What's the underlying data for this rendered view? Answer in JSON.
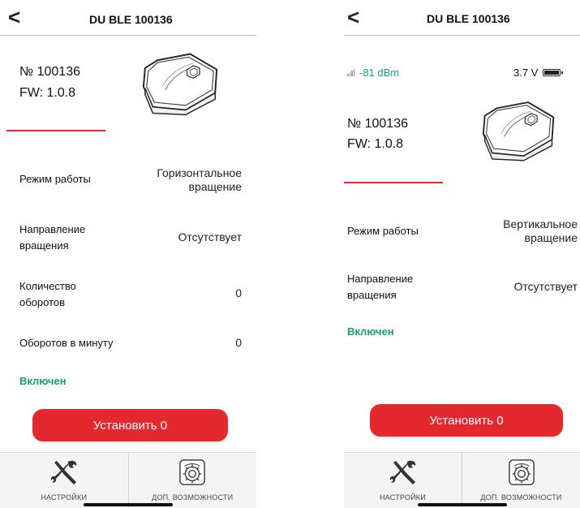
{
  "left": {
    "header": {
      "back_icon": "chevron-left-icon",
      "back_glyph": "<",
      "title": "DU BLE 100136"
    },
    "device": {
      "number": "№ 100136",
      "fw": "FW: 1.0.8"
    },
    "rows": [
      {
        "label": "Режим работы",
        "value": "Горизонтальное вращение"
      },
      {
        "label": "Направление вращения",
        "value": "Отсутствует"
      },
      {
        "label": "Количество оборотов",
        "value": "0"
      },
      {
        "label": "Оборотов в минуту",
        "value": "0"
      }
    ],
    "status": "Включен",
    "action_button": "Установить 0",
    "tabs": [
      {
        "label": "НАСТРОЙКИ",
        "icon": "wrench-screwdriver-icon"
      },
      {
        "label": "ДОП. ВОЗМОЖНОСТИ",
        "icon": "gear-icon"
      }
    ]
  },
  "right": {
    "header": {
      "back_icon": "chevron-left-icon",
      "back_glyph": "<",
      "title": "DU BLE 100136"
    },
    "signal": {
      "value": "-81 dBm",
      "icon": "signal-bars-icon"
    },
    "voltage": {
      "value": "3.7 V",
      "icon": "battery-icon"
    },
    "device": {
      "number": "№ 100136",
      "fw": "FW: 1.0.8"
    },
    "rows": [
      {
        "label": "Режим работы",
        "value": "Вертикальное вращение"
      },
      {
        "label": "Направление вращения",
        "value": "Отсутствует"
      }
    ],
    "status": "Включен",
    "action_button": "Установить 0",
    "tabs": [
      {
        "label": "НАСТРОЙКИ",
        "icon": "wrench-screwdriver-icon"
      },
      {
        "label": "ДОП. ВОЗМОЖНОСТИ",
        "icon": "gear-icon"
      }
    ]
  },
  "colors": {
    "accent_red": "#e3282e",
    "status_green": "#1aa06f",
    "signal_green": "#19a07a"
  }
}
